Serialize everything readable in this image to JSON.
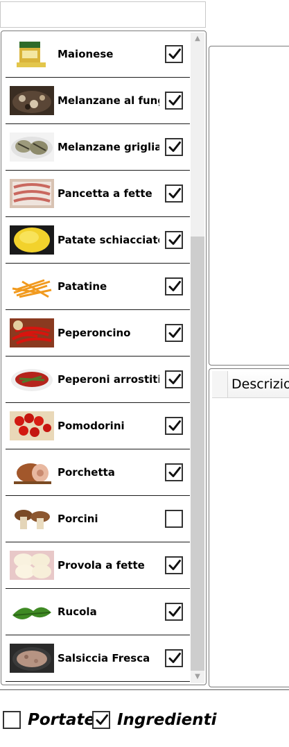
{
  "search": {
    "value": "",
    "placeholder": ""
  },
  "ingredients": [
    {
      "label": "Maionese",
      "checked": true,
      "icon": "mayonnaise-jar-icon"
    },
    {
      "label": "Melanzane al funghetto",
      "checked": true,
      "icon": "eggplant-mushroom-icon"
    },
    {
      "label": "Melanzane grigliate",
      "checked": true,
      "icon": "grilled-eggplant-icon"
    },
    {
      "label": "Pancetta a fette",
      "checked": true,
      "icon": "sliced-pancetta-icon"
    },
    {
      "label": "Patate schiacciate",
      "checked": true,
      "icon": "mashed-potatoes-icon"
    },
    {
      "label": "Patatine",
      "checked": true,
      "icon": "french-fries-icon"
    },
    {
      "label": "Peperoncino",
      "checked": true,
      "icon": "chili-pepper-icon"
    },
    {
      "label": "Peperoni arrostiti",
      "checked": true,
      "icon": "roasted-peppers-icon"
    },
    {
      "label": "Pomodorini",
      "checked": true,
      "icon": "cherry-tomatoes-icon"
    },
    {
      "label": "Porchetta",
      "checked": true,
      "icon": "porchetta-icon"
    },
    {
      "label": "Porcini",
      "checked": false,
      "icon": "porcini-mushroom-icon"
    },
    {
      "label": "Provola a fette",
      "checked": true,
      "icon": "provola-slices-icon"
    },
    {
      "label": "Rucola",
      "checked": true,
      "icon": "arugula-icon"
    },
    {
      "label": "Salsiccia Fresca",
      "checked": true,
      "icon": "fresh-sausage-icon"
    }
  ],
  "grid": {
    "column_header": "Descrizione"
  },
  "filters": {
    "portate": {
      "label": "Portate",
      "checked": false
    },
    "ingredienti": {
      "label": "Ingredienti",
      "checked": true
    }
  },
  "colors": {
    "border": "#7a7a7a",
    "scroll_track": "#f0f0f0",
    "scroll_thumb": "#cdcdcd",
    "check": "#111111"
  }
}
